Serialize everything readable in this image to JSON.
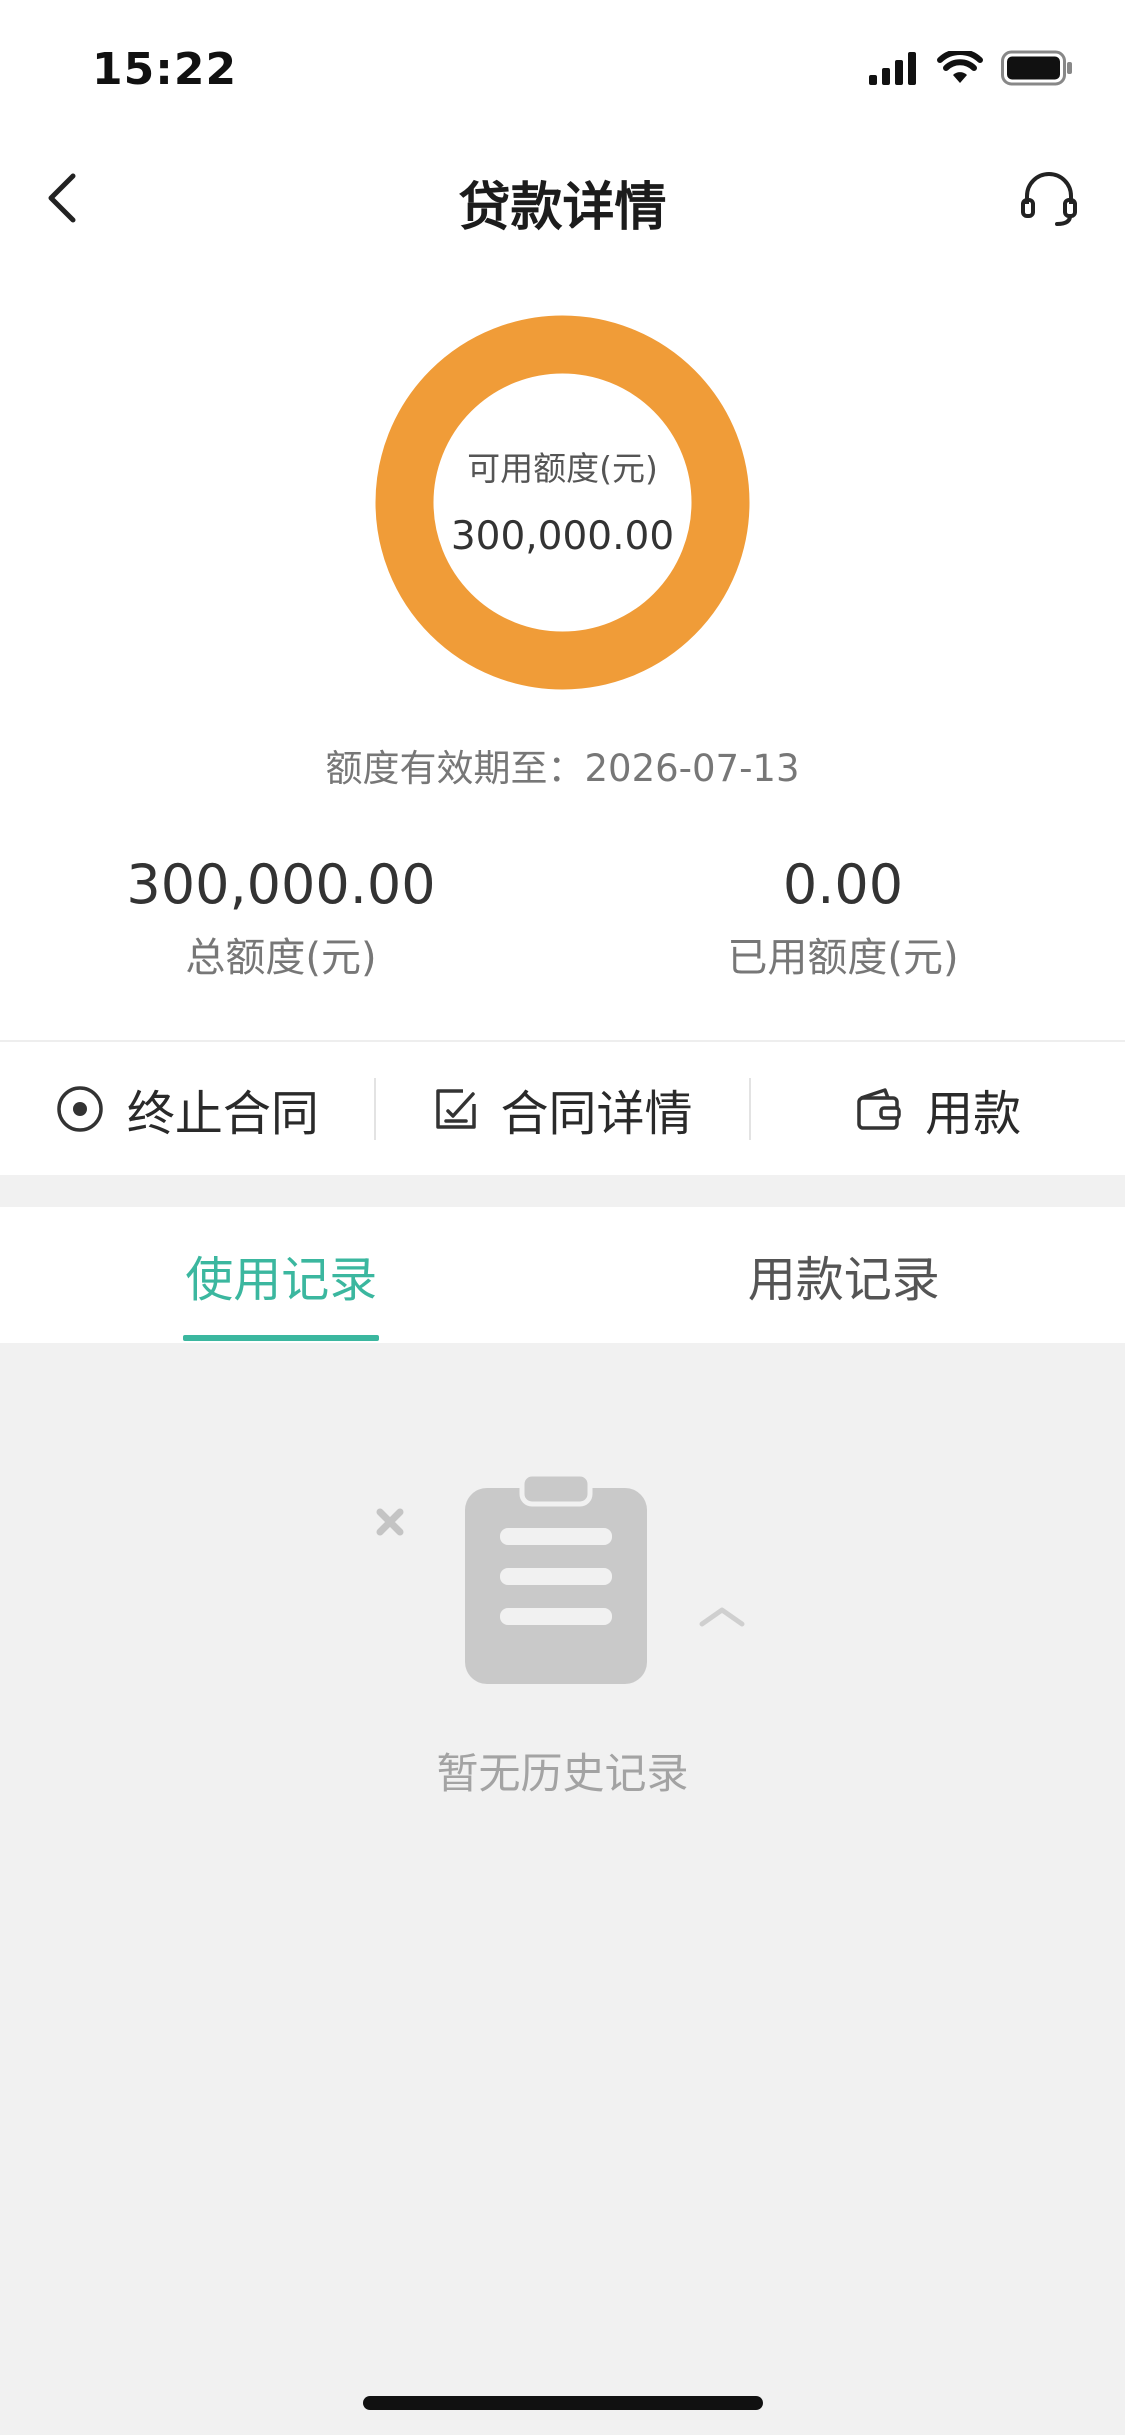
{
  "status_bar": {
    "time": "15:22"
  },
  "nav": {
    "title": "贷款详情"
  },
  "credit": {
    "available_label": "可用额度(元)",
    "available_value": "300,000.00",
    "validity": "额度有效期至：2026-07-13",
    "ring_color": "#F09C38"
  },
  "stats": {
    "total_value": "300,000.00",
    "total_label": "总额度(元)",
    "used_value": "0.00",
    "used_label": "已用额度(元)"
  },
  "actions": [
    {
      "label": "终止合同",
      "icon": "stop-circle-icon"
    },
    {
      "label": "合同详情",
      "icon": "edit-document-icon"
    },
    {
      "label": "用款",
      "icon": "wallet-icon"
    }
  ],
  "tabs": [
    {
      "label": "使用记录",
      "active": true
    },
    {
      "label": "用款记录",
      "active": false
    }
  ],
  "empty_state": {
    "text": "暂无历史记录",
    "icon": "clipboard-icon"
  },
  "colors": {
    "accent": "#3BB79F",
    "background": "#F1F1F1"
  }
}
